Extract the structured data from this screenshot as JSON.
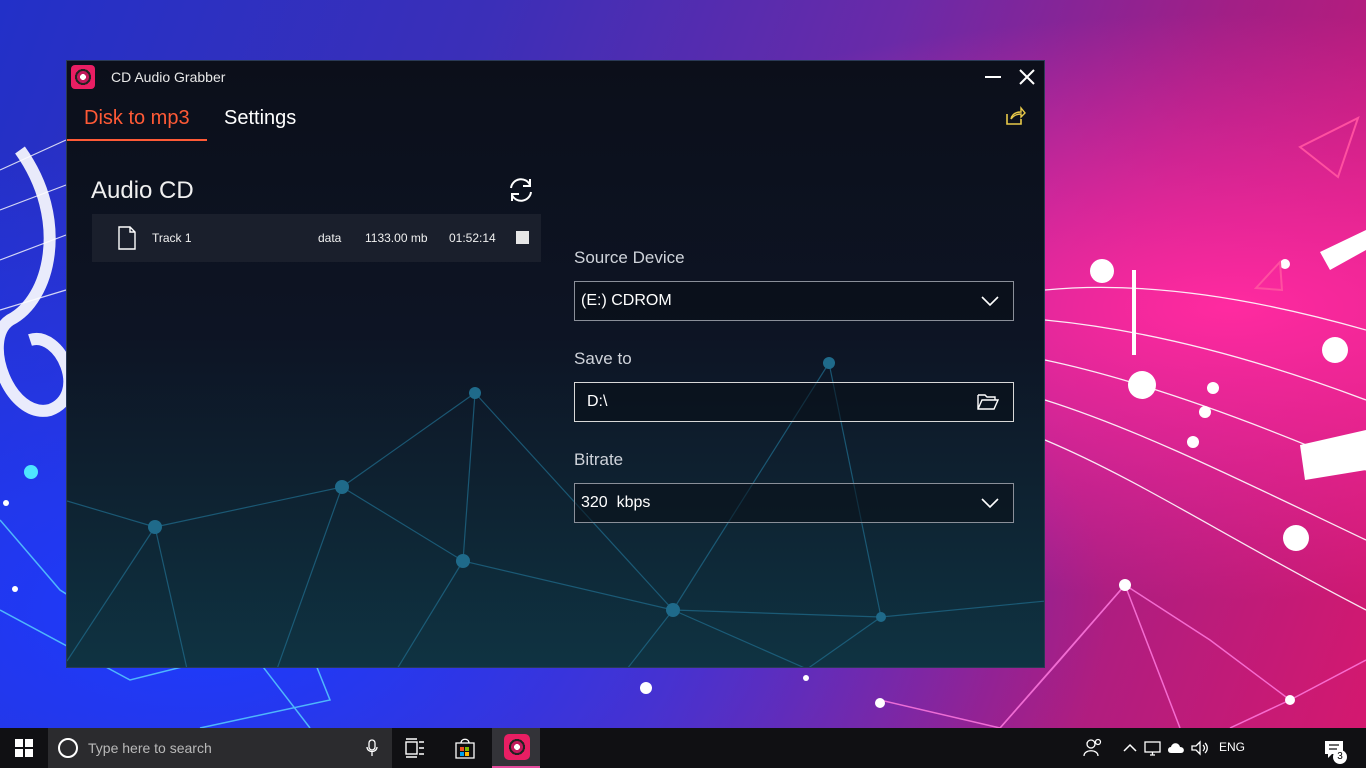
{
  "window": {
    "title": "CD Audio Grabber",
    "tabs": [
      {
        "label": "Disk to mp3",
        "active": true
      },
      {
        "label": "Settings",
        "active": false
      }
    ]
  },
  "audio_cd": {
    "title": "Audio CD",
    "tracks": [
      {
        "name": "Track 1",
        "type": "data",
        "size": "1133.00 mb",
        "duration": "01:52:14",
        "checked": false
      }
    ]
  },
  "source_device": {
    "label": "Source Device",
    "value": "(E:) CDROM"
  },
  "save_to": {
    "label": "Save to",
    "value": "D:\\"
  },
  "bitrate": {
    "label": "Bitrate",
    "value": "320  kbps"
  },
  "taskbar": {
    "search_placeholder": "Type here to search",
    "language": "ENG",
    "notification_count": "3"
  },
  "colors": {
    "accent": "#ff5a36",
    "window_bg": "#0c0f1a",
    "taskbar_bg": "#101013"
  },
  "icons": [
    "app-logo-icon",
    "minimize-icon",
    "close-icon",
    "share-icon",
    "refresh-icon",
    "file-icon",
    "checkbox",
    "chevron-down-icon",
    "folder-open-icon",
    "windows-start-icon",
    "cortana-icon",
    "microphone-icon",
    "task-view-icon",
    "store-icon",
    "people-icon",
    "chevron-up-icon",
    "network-icon",
    "cloud-icon",
    "volume-icon",
    "notification-icon"
  ]
}
